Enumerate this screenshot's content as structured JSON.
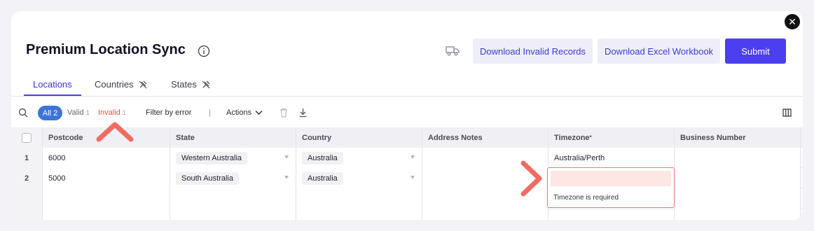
{
  "header": {
    "title": "Premium Location Sync",
    "buttons": {
      "download_invalid": "Download Invalid Records",
      "download_excel": "Download Excel Workbook",
      "submit": "Submit"
    },
    "close_symbol": "✕"
  },
  "tabs": [
    {
      "label": "Locations",
      "active": true
    },
    {
      "label": "Countries",
      "active": false
    },
    {
      "label": "States",
      "active": false
    }
  ],
  "toolbar": {
    "all_label": "All",
    "all_count": "2",
    "valid_label": "Valid",
    "valid_count": "1",
    "invalid_label": "Invalid",
    "invalid_count": "1",
    "filter_by_error": "Filter by error",
    "separator": "|",
    "actions": "Actions"
  },
  "table": {
    "columns": [
      "Postcode",
      "State",
      "Country",
      "Address Notes",
      "Timezone",
      "Business Number"
    ],
    "required_marker": "*",
    "rows": [
      {
        "num": "1",
        "postcode": "6000",
        "state": "Western Australia",
        "country": "Australia",
        "address_notes": "",
        "timezone": "Australia/Perth",
        "business_number": ""
      },
      {
        "num": "2",
        "postcode": "5000",
        "state": "South Australia",
        "country": "Australia",
        "address_notes": "",
        "timezone": "",
        "business_number": ""
      }
    ]
  },
  "error_popup": {
    "message": "Timezone is required"
  },
  "colors": {
    "primary": "#4b3ff0",
    "primary_light": "#eeeefa",
    "invalid": "#e0524a",
    "annotation_arrow": "#f26b60",
    "pill_all": "#3d74d8"
  },
  "icons": [
    "close-icon",
    "info-icon",
    "truck-icon",
    "pin-off-icon",
    "search-icon",
    "chevron-down-icon",
    "trash-icon",
    "download-icon",
    "columns-icon",
    "checkbox-icon"
  ]
}
